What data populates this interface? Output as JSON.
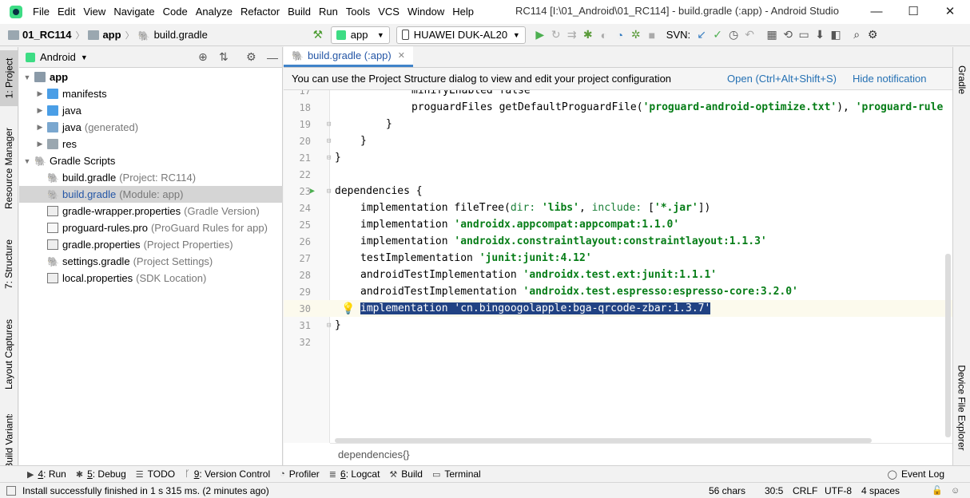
{
  "menu": [
    "File",
    "Edit",
    "View",
    "Navigate",
    "Code",
    "Analyze",
    "Refactor",
    "Build",
    "Run",
    "Tools",
    "VCS",
    "Window",
    "Help"
  ],
  "window_title": "RC114 [I:\\01_Android\\01_RC114] - build.gradle (:app) - Android Studio",
  "breadcrumb": [
    "01_RC114",
    "app",
    "build.gradle"
  ],
  "toolbar": {
    "config": "app",
    "device": "HUAWEI DUK-AL20",
    "svn_label": "SVN:"
  },
  "left_tabs": [
    "1: Project",
    "Resource Manager",
    "7: Structure",
    "Layout Captures",
    "Build Variants"
  ],
  "right_tabs": [
    "Gradle",
    "Device File Explorer"
  ],
  "project_view": "Android",
  "tree": [
    {
      "label": "app",
      "hint": "",
      "bold": true
    },
    {
      "label": "manifests",
      "hint": ""
    },
    {
      "label": "java",
      "hint": ""
    },
    {
      "label": "java",
      "hint": "(generated)"
    },
    {
      "label": "res",
      "hint": ""
    },
    {
      "label": "Gradle Scripts",
      "hint": ""
    },
    {
      "label": "build.gradle",
      "hint": "(Project: RC114)"
    },
    {
      "label": "build.gradle",
      "hint": "(Module: app)"
    },
    {
      "label": "gradle-wrapper.properties",
      "hint": "(Gradle Version)"
    },
    {
      "label": "proguard-rules.pro",
      "hint": "(ProGuard Rules for app)"
    },
    {
      "label": "gradle.properties",
      "hint": "(Project Properties)"
    },
    {
      "label": "settings.gradle",
      "hint": "(Project Settings)"
    },
    {
      "label": "local.properties",
      "hint": "(SDK Location)"
    }
  ],
  "editor_tab": "build.gradle (:app)",
  "notification": {
    "text": "You can use the Project Structure dialog to view and edit your project configuration",
    "open": "Open (Ctrl+Alt+Shift+S)",
    "hide": "Hide notification"
  },
  "line_numbers": [
    "17",
    "18",
    "19",
    "20",
    "21",
    "22",
    "23",
    "24",
    "25",
    "26",
    "27",
    "28",
    "29",
    "30",
    "31",
    "32"
  ],
  "code": {
    "l17": "minifyEnabled false",
    "l18a": "proguardFiles getDefaultProguardFile(",
    "l18b": "'proguard-android-optimize.txt'",
    "l18c": "), ",
    "l18d": "'proguard-rule",
    "l19": "}",
    "l20": "}",
    "l21": "}",
    "l23": "dependencies {",
    "l24a": "implementation fileTree(",
    "l24b": "dir: ",
    "l24c": "'libs'",
    "l24d": ", ",
    "l24e": "include: ",
    "l24f": "[",
    "l24g": "'*.jar'",
    "l24h": "])",
    "l25a": "implementation ",
    "l25b": "'androidx.appcompat:appcompat:1.1.0'",
    "l26a": "implementation ",
    "l26b": "'androidx.constraintlayout:constraintlayout:1.1.3'",
    "l27a": "testImplementation ",
    "l27b": "'junit:junit:4.12'",
    "l28a": "androidTestImplementation ",
    "l28b": "'androidx.test.ext:junit:1.1.1'",
    "l29a": "androidTestImplementation ",
    "l29b": "'androidx.test.espresso:espresso-core:3.2.0'",
    "l30a": "implementation ",
    "l30b": "'cn.bingoogolapple:bga-qrcode-zbar:1.3.7'",
    "l31": "}"
  },
  "editor_breadcrumb": "dependencies{}",
  "tool_windows": [
    {
      "key": "4",
      "label": ": Run"
    },
    {
      "key": "5",
      "label": ": Debug"
    },
    {
      "key": "",
      "label": "TODO"
    },
    {
      "key": "9",
      "label": ": Version Control"
    },
    {
      "key": "",
      "label": "Profiler"
    },
    {
      "key": "6",
      "label": ": Logcat"
    },
    {
      "key": "",
      "label": "Build"
    },
    {
      "key": "",
      "label": "Terminal"
    }
  ],
  "event_log": "Event Log",
  "status": {
    "message": "Install successfully finished in 1 s 315 ms. (2 minutes ago)",
    "chars": "56 chars",
    "position": "30:5",
    "line_sep": "CRLF",
    "encoding": "UTF-8",
    "indent": "4 spaces"
  }
}
